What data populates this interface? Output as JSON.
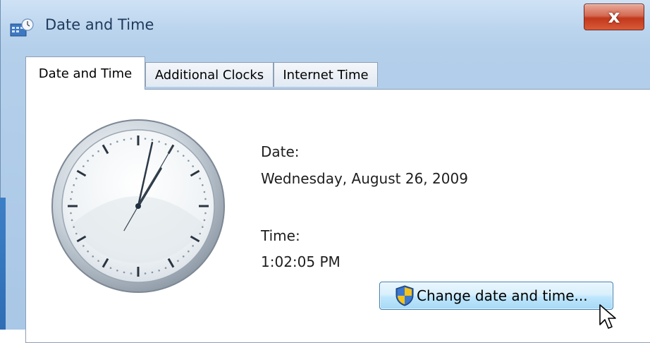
{
  "window": {
    "title": "Date and Time",
    "close_label": "x"
  },
  "tabs": [
    {
      "label": "Date and Time",
      "active": true
    },
    {
      "label": "Additional Clocks",
      "active": false
    },
    {
      "label": "Internet Time",
      "active": false
    }
  ],
  "date": {
    "label": "Date:",
    "value": "Wednesday, August 26, 2009"
  },
  "time": {
    "label": "Time:",
    "value": "1:02:05 PM"
  },
  "clock": {
    "hour": 1,
    "minute": 2,
    "second": 5
  },
  "actions": {
    "change_label": "Change date and time..."
  },
  "icons": {
    "app": "date-time-icon",
    "close": "close-icon",
    "shield": "uac-shield-icon",
    "cursor": "mouse-pointer-icon"
  },
  "colors": {
    "title_text": "#1e395b",
    "close_button": "#c2391d",
    "button_border": "#3c7fb1"
  }
}
